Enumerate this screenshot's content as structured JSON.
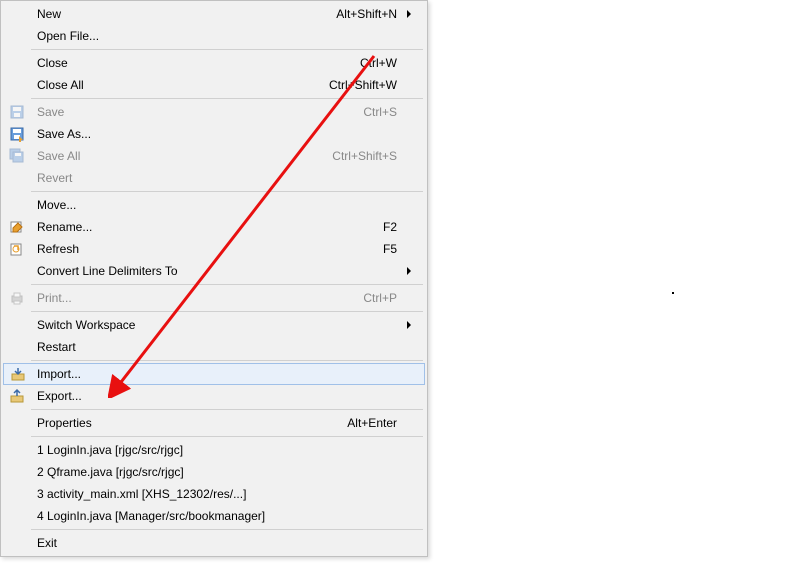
{
  "menu": {
    "groups": [
      [
        {
          "label": "New",
          "shortcut": "Alt+Shift+N",
          "icon": "",
          "submenu": true,
          "disabled": false
        },
        {
          "label": "Open File...",
          "shortcut": "",
          "icon": "",
          "submenu": false,
          "disabled": false
        }
      ],
      [
        {
          "label": "Close",
          "shortcut": "Ctrl+W",
          "icon": "",
          "submenu": false,
          "disabled": false
        },
        {
          "label": "Close All",
          "shortcut": "Ctrl+Shift+W",
          "icon": "",
          "submenu": false,
          "disabled": false
        }
      ],
      [
        {
          "label": "Save",
          "shortcut": "Ctrl+S",
          "icon": "save",
          "submenu": false,
          "disabled": true
        },
        {
          "label": "Save As...",
          "shortcut": "",
          "icon": "saveas",
          "submenu": false,
          "disabled": false
        },
        {
          "label": "Save All",
          "shortcut": "Ctrl+Shift+S",
          "icon": "saveall",
          "submenu": false,
          "disabled": true
        },
        {
          "label": "Revert",
          "shortcut": "",
          "icon": "",
          "submenu": false,
          "disabled": true
        }
      ],
      [
        {
          "label": "Move...",
          "shortcut": "",
          "icon": "",
          "submenu": false,
          "disabled": false
        },
        {
          "label": "Rename...",
          "shortcut": "F2",
          "icon": "rename",
          "submenu": false,
          "disabled": false
        },
        {
          "label": "Refresh",
          "shortcut": "F5",
          "icon": "refresh",
          "submenu": false,
          "disabled": false
        },
        {
          "label": "Convert Line Delimiters To",
          "shortcut": "",
          "icon": "",
          "submenu": true,
          "disabled": false
        }
      ],
      [
        {
          "label": "Print...",
          "shortcut": "Ctrl+P",
          "icon": "print",
          "submenu": false,
          "disabled": true
        }
      ],
      [
        {
          "label": "Switch Workspace",
          "shortcut": "",
          "icon": "",
          "submenu": true,
          "disabled": false
        },
        {
          "label": "Restart",
          "shortcut": "",
          "icon": "",
          "submenu": false,
          "disabled": false
        }
      ],
      [
        {
          "label": "Import...",
          "shortcut": "",
          "icon": "import",
          "submenu": false,
          "disabled": false,
          "highlight": true
        },
        {
          "label": "Export...",
          "shortcut": "",
          "icon": "export",
          "submenu": false,
          "disabled": false
        }
      ],
      [
        {
          "label": "Properties",
          "shortcut": "Alt+Enter",
          "icon": "",
          "submenu": false,
          "disabled": false
        }
      ],
      [
        {
          "label": "1 LoginIn.java  [rjgc/src/rjgc]",
          "shortcut": "",
          "icon": "",
          "submenu": false,
          "disabled": false
        },
        {
          "label": "2 Qframe.java  [rjgc/src/rjgc]",
          "shortcut": "",
          "icon": "",
          "submenu": false,
          "disabled": false
        },
        {
          "label": "3 activity_main.xml  [XHS_12302/res/...]",
          "shortcut": "",
          "icon": "",
          "submenu": false,
          "disabled": false
        },
        {
          "label": "4 LoginIn.java  [Manager/src/bookmanager]",
          "shortcut": "",
          "icon": "",
          "submenu": false,
          "disabled": false
        }
      ],
      [
        {
          "label": "Exit",
          "shortcut": "",
          "icon": "",
          "submenu": false,
          "disabled": false
        }
      ]
    ]
  }
}
